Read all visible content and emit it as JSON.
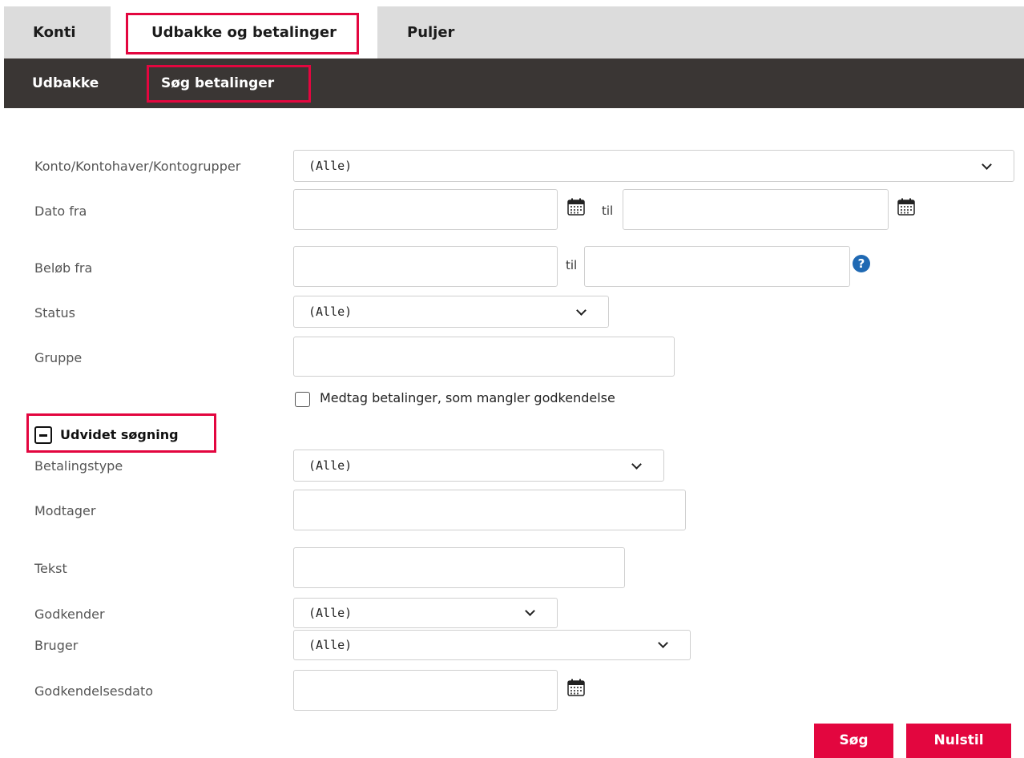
{
  "tabs": {
    "konti": "Konti",
    "udbakke_betalinger": "Udbakke og betalinger",
    "puljer": "Puljer"
  },
  "subtabs": {
    "udbakke": "Udbakke",
    "soeg_betalinger": "Søg betalinger"
  },
  "form": {
    "konto": {
      "label": "Konto/Kontohaver/Kontogrupper",
      "value": "(Alle)"
    },
    "dato": {
      "label": "Dato fra",
      "from_value": "",
      "til_label": "til",
      "to_value": ""
    },
    "beloeb": {
      "label": "Beløb fra",
      "from_value": "",
      "til_label": "til",
      "to_value": "",
      "help": "?"
    },
    "status": {
      "label": "Status",
      "value": "(Alle)"
    },
    "gruppe": {
      "label": "Gruppe",
      "value": ""
    },
    "include_unapproved": {
      "label": "Medtag betalinger, som mangler godkendelse",
      "checked": false
    }
  },
  "advanced": {
    "toggle_label": "Udvidet søgning",
    "betalingstype": {
      "label": "Betalingstype",
      "value": "(Alle)"
    },
    "modtager": {
      "label": "Modtager",
      "value": ""
    },
    "tekst": {
      "label": "Tekst",
      "value": ""
    },
    "godkender": {
      "label": "Godkender",
      "value": "(Alle)"
    },
    "bruger": {
      "label": "Bruger",
      "value": "(Alle)"
    },
    "godkendelsesdato": {
      "label": "Godkendelsesdato",
      "value": ""
    }
  },
  "buttons": {
    "search": "Søg",
    "reset": "Nulstil"
  },
  "icons": {
    "calendar": "calendar-icon",
    "help": "help-icon",
    "chevron": "chevron-down-icon",
    "collapse": "minus-square-icon"
  },
  "colors": {
    "accent": "#e3063f",
    "tabbar": "#dcdcdc",
    "subbar": "#3a3634",
    "help": "#1f69b3"
  }
}
